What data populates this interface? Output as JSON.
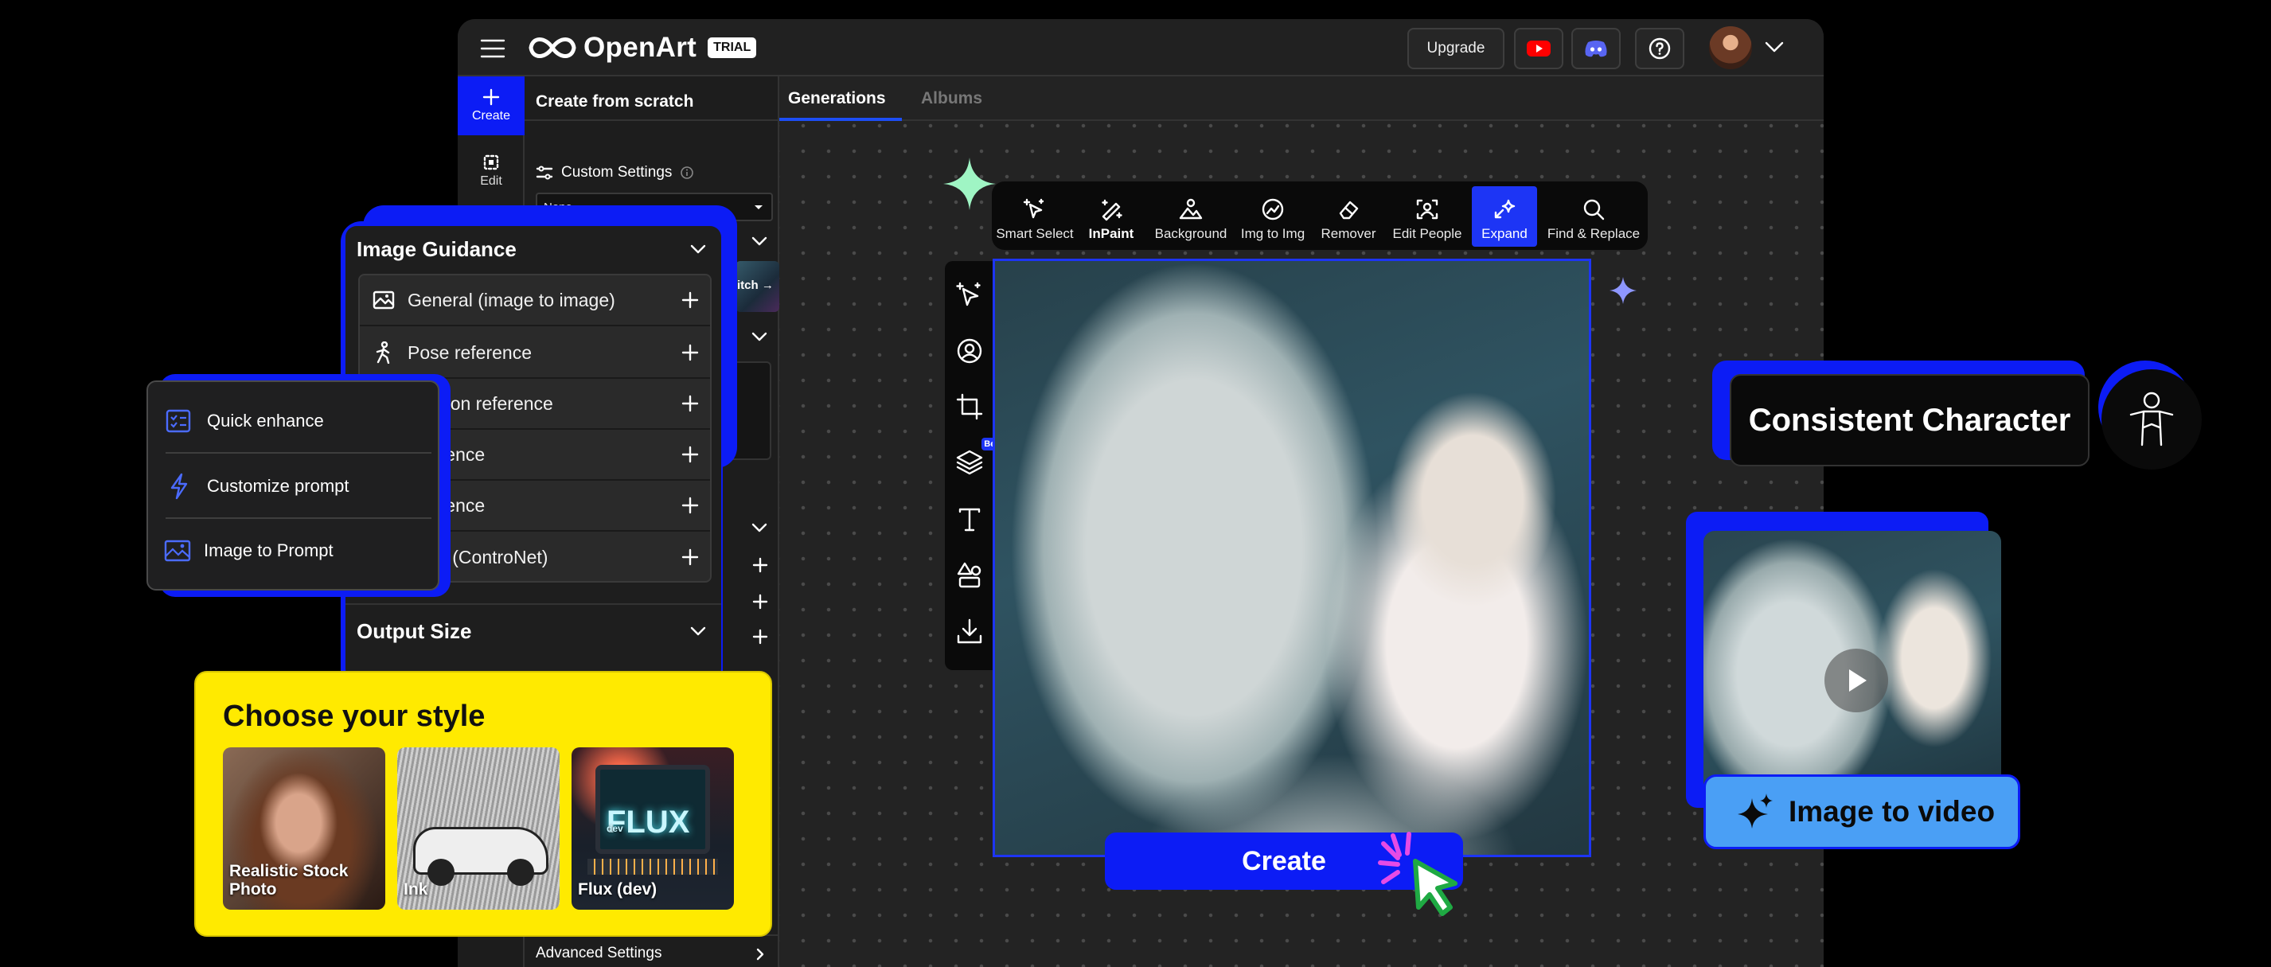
{
  "header": {
    "brand": "OpenArt",
    "trial_badge": "TRIAL",
    "upgrade_label": "Upgrade"
  },
  "leftnav": {
    "create_label": "Create",
    "edit_label": "Edit"
  },
  "panel": {
    "title": "Create from scratch",
    "custom_settings_label": "Custom Settings",
    "custom_settings_value": "None",
    "thumb_text": "itch →",
    "advanced_settings_label": "Advanced Settings"
  },
  "tabs": [
    {
      "label": "Generations",
      "active": true
    },
    {
      "label": "Albums",
      "active": false
    }
  ],
  "toolbar": [
    {
      "label": "Smart Select",
      "icon": "smart-select-icon"
    },
    {
      "label": "InPaint",
      "icon": "inpaint-icon"
    },
    {
      "label": "Background",
      "icon": "background-icon"
    },
    {
      "label": "Img to Img",
      "icon": "img-to-img-icon"
    },
    {
      "label": "Remover",
      "icon": "eraser-icon"
    },
    {
      "label": "Edit People",
      "icon": "edit-people-icon"
    },
    {
      "label": "Expand",
      "icon": "expand-icon",
      "active": true
    },
    {
      "label": "Find & Replace",
      "icon": "search-icon"
    }
  ],
  "side_toolbar": {
    "beta_badge": "Bet"
  },
  "image_guidance": {
    "title": "Image Guidance",
    "items": [
      {
        "label": "General (image to image)",
        "icon": "image-icon"
      },
      {
        "label": "Pose reference",
        "icon": "pose-icon"
      },
      {
        "label": "position reference"
      },
      {
        "label": "reference"
      },
      {
        "label": "reference"
      },
      {
        "label": "nced (ControNet)"
      }
    ],
    "output_size_label": "Output Size"
  },
  "prompt_menu": {
    "items": [
      {
        "label": "Quick enhance",
        "icon": "checklist-icon"
      },
      {
        "label": "Customize prompt",
        "icon": "lightning-icon"
      },
      {
        "label": "Image to Prompt",
        "icon": "image-icon"
      }
    ]
  },
  "style_card": {
    "title": "Choose your style",
    "styles": [
      {
        "label": "Realistic Stock Photo"
      },
      {
        "label": "Ink"
      },
      {
        "label": "Flux (dev)"
      }
    ],
    "flux_logo": "FLUX",
    "flux_sub": "dev"
  },
  "create_button_label": "Create",
  "consistent_character_label": "Consistent Character",
  "image_to_video_label": "Image to video",
  "colors": {
    "brand_blue": "#0c1cf5",
    "style_yellow": "#ffea00",
    "video_blue": "#4a9ff5",
    "youtube_red": "#ff0000",
    "discord_blue": "#5865f2",
    "sparkle_green": "#9ff5c4"
  }
}
